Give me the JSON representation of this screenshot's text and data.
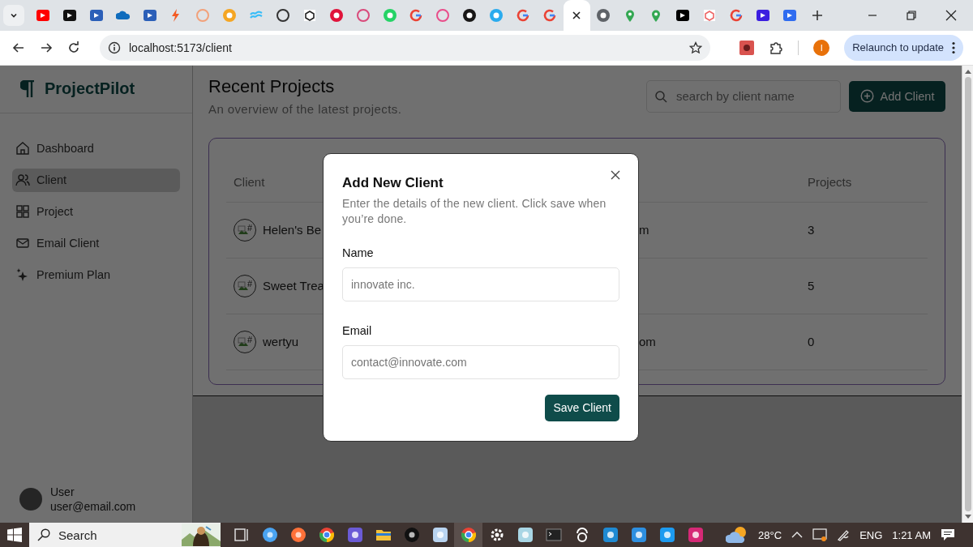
{
  "browser": {
    "tabs": [
      {
        "selected": false
      },
      {
        "selected": false
      },
      {
        "selected": false
      },
      {
        "selected": false
      },
      {
        "selected": false
      },
      {
        "selected": false
      },
      {
        "selected": false
      },
      {
        "selected": false
      },
      {
        "selected": false
      },
      {
        "selected": false
      },
      {
        "selected": false
      },
      {
        "selected": false
      },
      {
        "selected": false
      },
      {
        "selected": false
      },
      {
        "selected": false
      },
      {
        "selected": false
      },
      {
        "selected": false
      },
      {
        "selected": false
      },
      {
        "selected": false
      },
      {
        "selected": false
      },
      {
        "selected": true
      },
      {
        "selected": false
      },
      {
        "selected": false
      },
      {
        "selected": false
      },
      {
        "selected": false
      },
      {
        "selected": false
      },
      {
        "selected": false
      },
      {
        "selected": false
      },
      {
        "selected": false
      }
    ],
    "url": "localhost:5173/client",
    "profile_initial": "I",
    "relaunch_label": "Relaunch to update"
  },
  "sidebar": {
    "brand": "ProjectPilot",
    "items": [
      {
        "label": "Dashboard",
        "selected": false
      },
      {
        "label": "Client",
        "selected": true
      },
      {
        "label": "Project",
        "selected": false
      },
      {
        "label": "Email Client",
        "selected": false
      },
      {
        "label": "Premium Plan",
        "selected": false
      }
    ],
    "user": {
      "name": "User",
      "email": "user@email.com"
    }
  },
  "header": {
    "title": "Recent Projects",
    "subtitle": "An overview of the latest projects.",
    "search_placeholder": "search by client name",
    "add_button": "Add Client"
  },
  "table": {
    "columns": [
      "Client",
      "Projects"
    ],
    "rows": [
      {
        "avatar_text": "#",
        "client": "Helen's Be",
        "email": "m",
        "projects": "3"
      },
      {
        "avatar_text": "#",
        "client": "Sweet Trea",
        "projects": "5"
      },
      {
        "avatar_text": "#",
        "client": "wertyu",
        "email": "om",
        "projects": "0"
      }
    ]
  },
  "dialog": {
    "title": "Add New Client",
    "description": "Enter the details of the new client. Click save when you’re done.",
    "fields": [
      {
        "label": "Name",
        "placeholder": "innovate inc."
      },
      {
        "label": "Email",
        "placeholder": "contact@innovate.com"
      }
    ],
    "save_button": "Save Client"
  },
  "taskbar": {
    "search_label": "Search",
    "apps": [
      {
        "selected": false
      },
      {
        "selected": false
      },
      {
        "selected": false
      },
      {
        "selected": false
      },
      {
        "selected": false
      },
      {
        "selected": false
      },
      {
        "selected": false
      },
      {
        "selected": false
      },
      {
        "selected": true
      },
      {
        "selected": false
      },
      {
        "selected": false
      },
      {
        "selected": false
      },
      {
        "selected": false
      },
      {
        "selected": false
      },
      {
        "selected": false
      },
      {
        "selected": false
      },
      {
        "selected": false
      }
    ],
    "temperature": "28°C",
    "language": "ENG",
    "time": "1:21 AM"
  }
}
